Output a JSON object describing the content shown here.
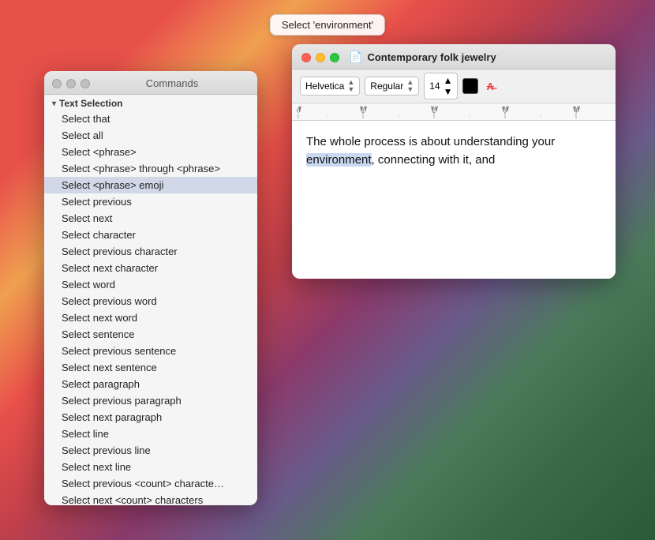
{
  "background": {},
  "tooltip": {
    "text": "Select 'environment'"
  },
  "commands_window": {
    "title": "Commands",
    "traffic_lights": [
      "close",
      "minimize",
      "maximize"
    ],
    "section": {
      "label": "Text Selection",
      "chevron": "▾",
      "items": [
        {
          "label": "Select that",
          "highlighted": false
        },
        {
          "label": "Select all",
          "highlighted": false
        },
        {
          "label": "Select <phrase>",
          "highlighted": false
        },
        {
          "label": "Select <phrase> through <phrase>",
          "highlighted": false
        },
        {
          "label": "Select <phrase> emoji",
          "highlighted": true
        },
        {
          "label": "Select previous",
          "highlighted": false
        },
        {
          "label": "Select next",
          "highlighted": false
        },
        {
          "label": "Select character",
          "highlighted": false
        },
        {
          "label": "Select previous character",
          "highlighted": false
        },
        {
          "label": "Select next character",
          "highlighted": false
        },
        {
          "label": "Select word",
          "highlighted": false
        },
        {
          "label": "Select previous word",
          "highlighted": false
        },
        {
          "label": "Select next word",
          "highlighted": false
        },
        {
          "label": "Select sentence",
          "highlighted": false
        },
        {
          "label": "Select previous sentence",
          "highlighted": false
        },
        {
          "label": "Select next sentence",
          "highlighted": false
        },
        {
          "label": "Select paragraph",
          "highlighted": false
        },
        {
          "label": "Select previous paragraph",
          "highlighted": false
        },
        {
          "label": "Select next paragraph",
          "highlighted": false
        },
        {
          "label": "Select line",
          "highlighted": false
        },
        {
          "label": "Select previous line",
          "highlighted": false
        },
        {
          "label": "Select next line",
          "highlighted": false
        },
        {
          "label": "Select previous <count> characte…",
          "highlighted": false
        },
        {
          "label": "Select next <count> characters",
          "highlighted": false
        }
      ]
    }
  },
  "doc_window": {
    "title": "Contemporary folk jewelry",
    "icon": "📄",
    "traffic_lights": [
      "close",
      "minimize",
      "maximize"
    ],
    "toolbar": {
      "font": "Helvetica",
      "style": "Regular",
      "size": "14",
      "color": "#000000"
    },
    "ruler": {
      "marks": [
        "0",
        "1",
        "2",
        "3",
        "4"
      ]
    },
    "body": {
      "text_before": "The whole process is about understanding your ",
      "highlight": "environment",
      "text_after": ", connecting with it, and"
    }
  }
}
